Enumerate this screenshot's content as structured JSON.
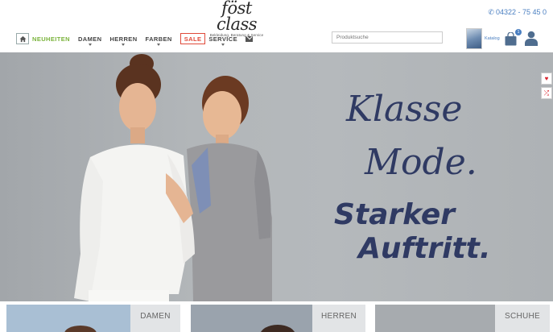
{
  "header": {
    "logo_text": "föst class",
    "logo_tagline": "Bekleidung, Beratung & Service",
    "phone": "04322 - 75 45 0",
    "phone_icon": "phone-icon"
  },
  "nav": {
    "home_icon": "home-icon",
    "items": [
      {
        "label": "NEUHEITEN"
      },
      {
        "label": "DAMEN"
      },
      {
        "label": "HERREN"
      },
      {
        "label": "FARBEN"
      },
      {
        "label": "SALE"
      },
      {
        "label": "SERVICE"
      }
    ],
    "mail_icon": "envelope-icon"
  },
  "search": {
    "placeholder": "Produktsuche"
  },
  "catalog": {
    "label": "Katalog"
  },
  "cart": {
    "count": "1"
  },
  "hero": {
    "lines": [
      "Klasse",
      "Mode.",
      "Starker",
      "Auftritt."
    ]
  },
  "side_tabs": {
    "wishlist_icon": "heart-icon",
    "compare_icon": "shuffle-icon"
  },
  "tiles": [
    {
      "label": "DAMEN"
    },
    {
      "label": "HERREN"
    },
    {
      "label": "SCHUHE"
    }
  ],
  "colors": {
    "accent_blue": "#4a7fc1",
    "new_green": "#7ab33b",
    "sale_red": "#e04a3a",
    "slogan_navy": "#2f3a63"
  }
}
